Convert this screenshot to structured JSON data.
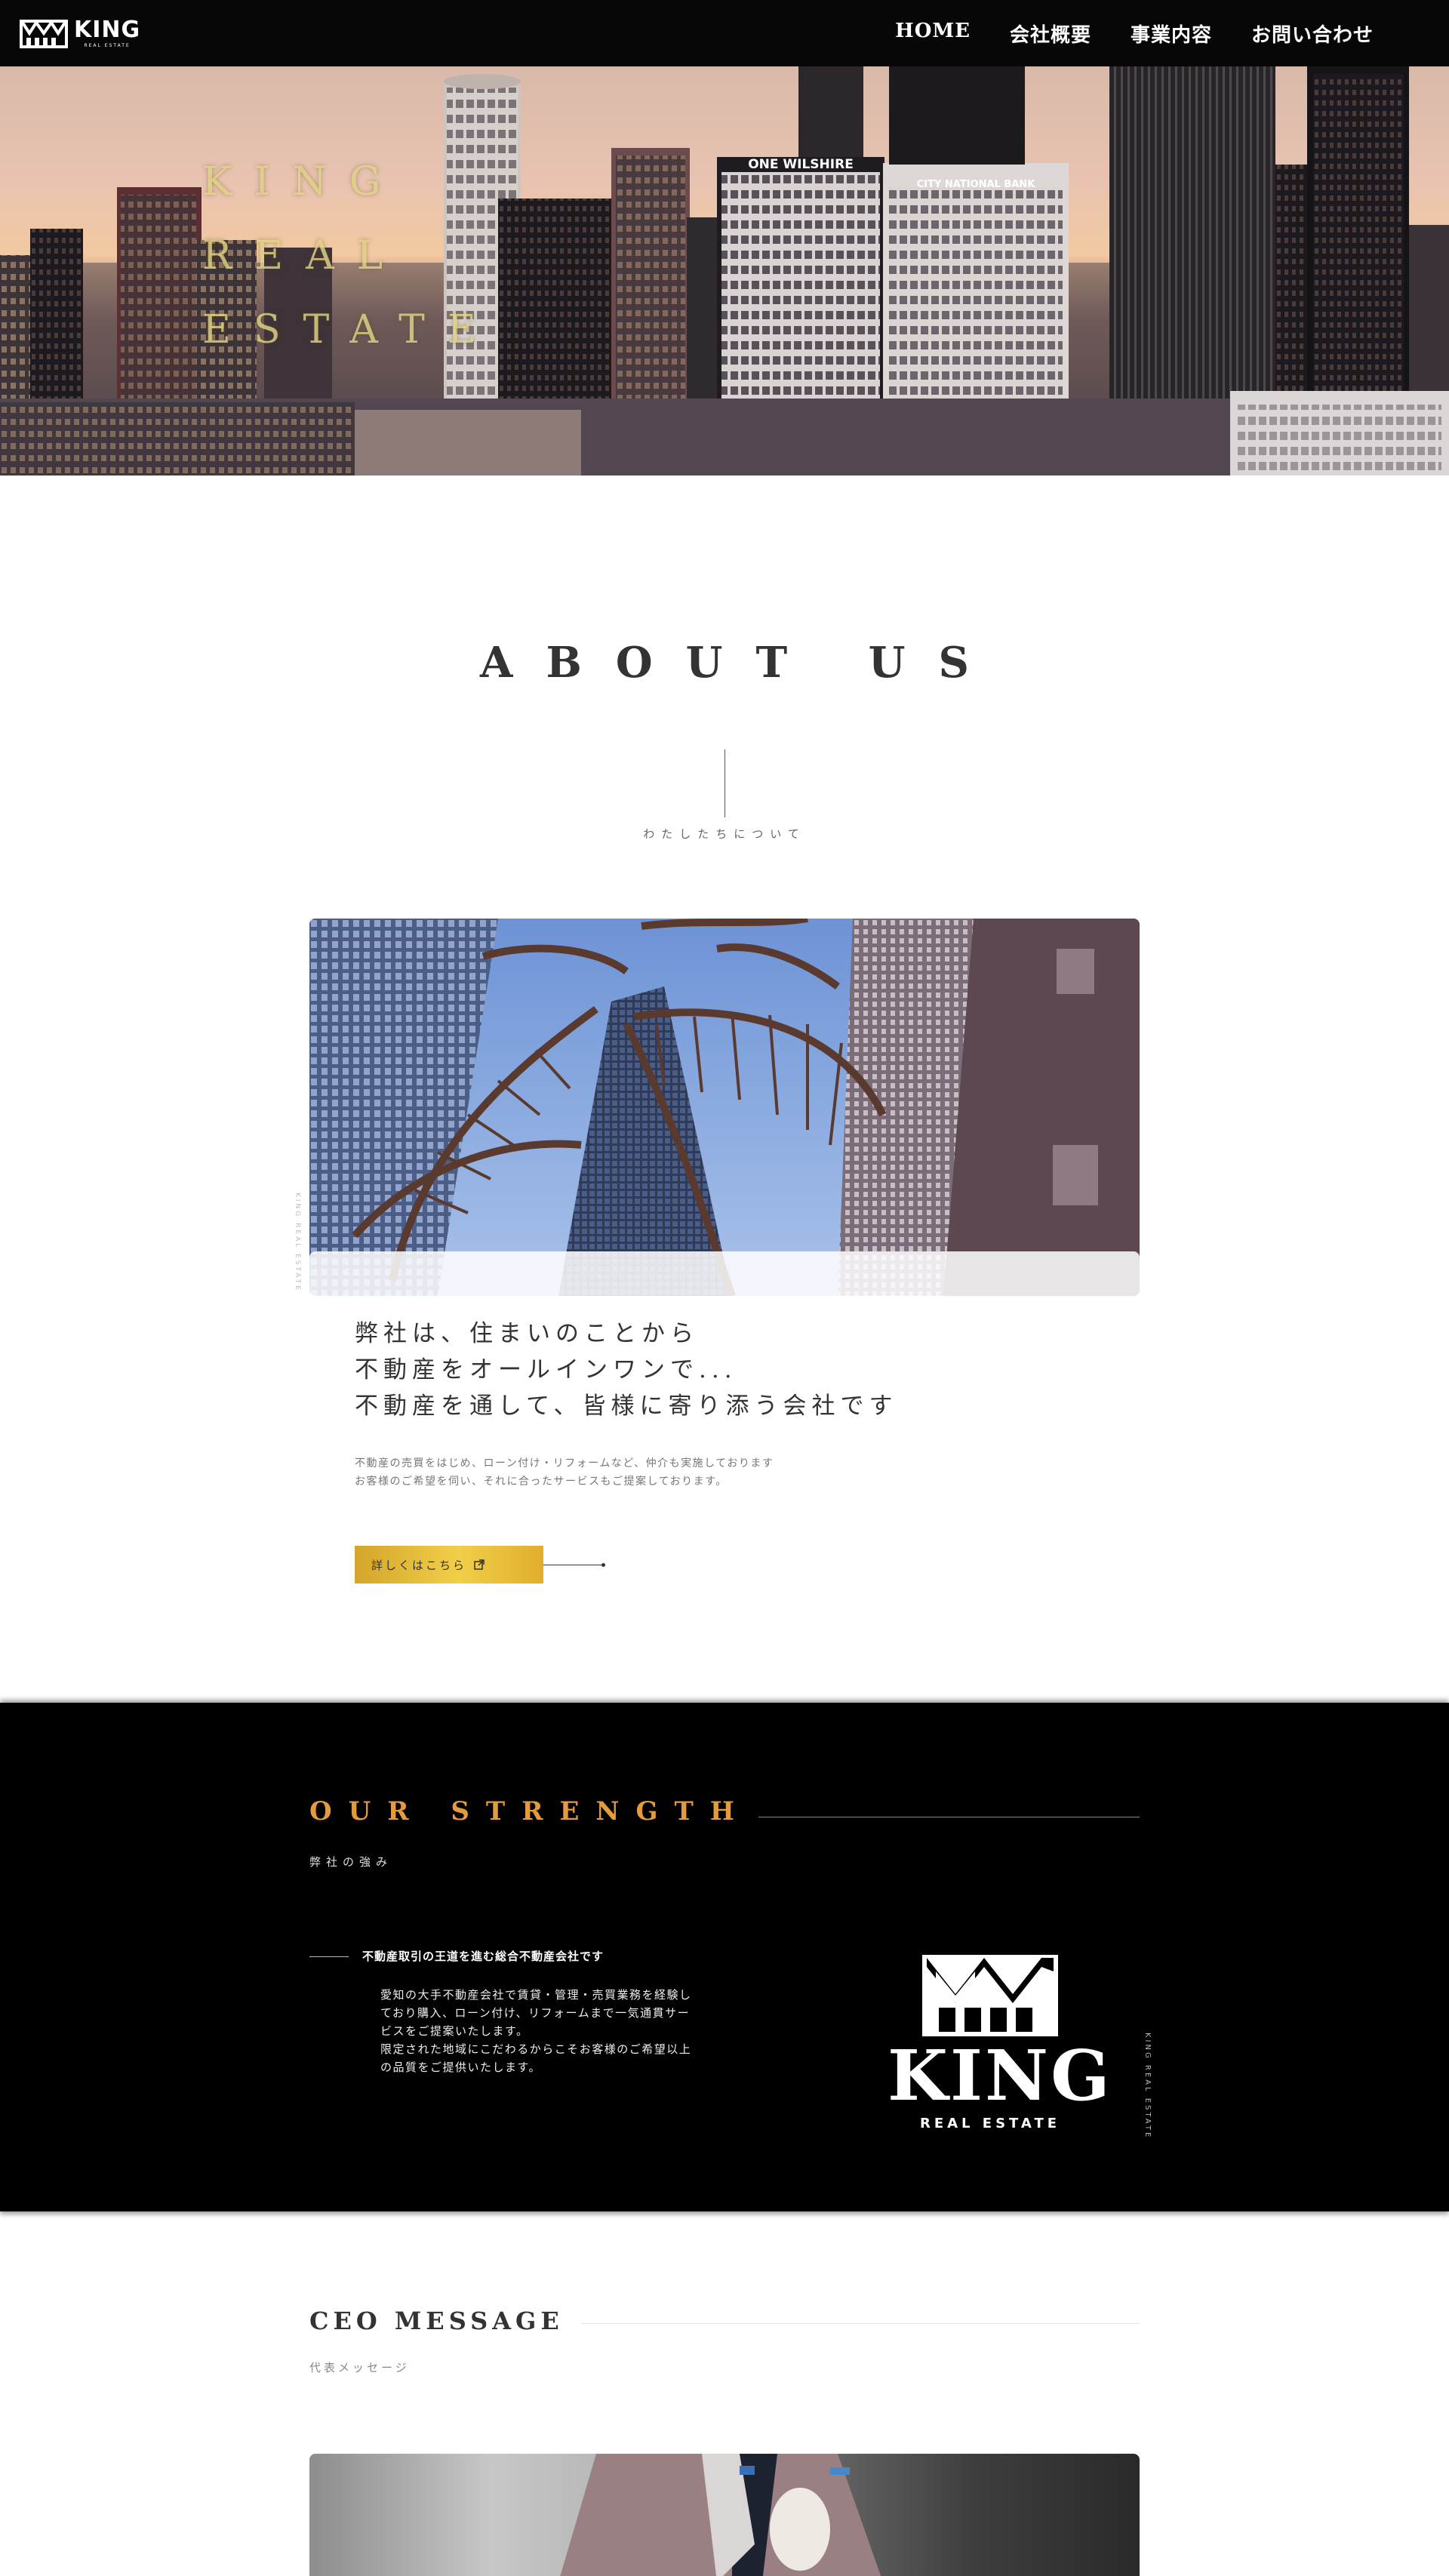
{
  "header": {
    "logo_text": "KING",
    "logo_subtext": "REAL ESTATE",
    "nav": [
      "HOME",
      "会社概要",
      "事業内容",
      "お問い合わせ"
    ]
  },
  "hero": {
    "title_lines": [
      "KING",
      "REAL",
      "ESTATE"
    ],
    "sign_one_wilshire": "ONE WILSHIRE",
    "sign_city_national": "CITY NATIONAL BANK"
  },
  "about": {
    "title": "ABOUT US",
    "subtitle": "わたしたちについて",
    "side_text": "KING REAL ESTATE",
    "heading_lines": [
      "弊社は、住まいのことから",
      "不動産をオールインワンで...",
      "不動産を通して、皆様に寄り添う会社です"
    ],
    "body_lines": [
      "不動産の売買をはじめ、ローン付け・リフォームなど、仲介も実施しております",
      "お客様のご希望を伺い、それに合ったサービスもご提案しております。"
    ],
    "button_label": "詳しくはこちら"
  },
  "strength": {
    "title": "OUR STRENGTH",
    "subtitle": "弊社の強み",
    "lead": "不動産取引の王道を進む総合不動産会社です",
    "body_lines": [
      "愛知の大手不動産会社で賃貸・管理・売買業務を経験し",
      "ており購入、ローン付け、リフォームまで一気通貫サー",
      "ビスをご提案いたします。",
      "限定された地域にこだわるからこそお客様のご希望以上",
      "の品質をご提供いたします。"
    ],
    "logo_text": "KING",
    "logo_subtext": "REAL ESTATE",
    "side_text": "KING REAL ESTATE",
    "accent_color": "#e49b3c"
  },
  "ceo": {
    "title": "CEO MESSAGE",
    "subtitle": "代表メッセージ"
  },
  "colors": {
    "header_bg": "#070707",
    "button_gold": "#f1cf49",
    "strength_bg": "#000000"
  }
}
